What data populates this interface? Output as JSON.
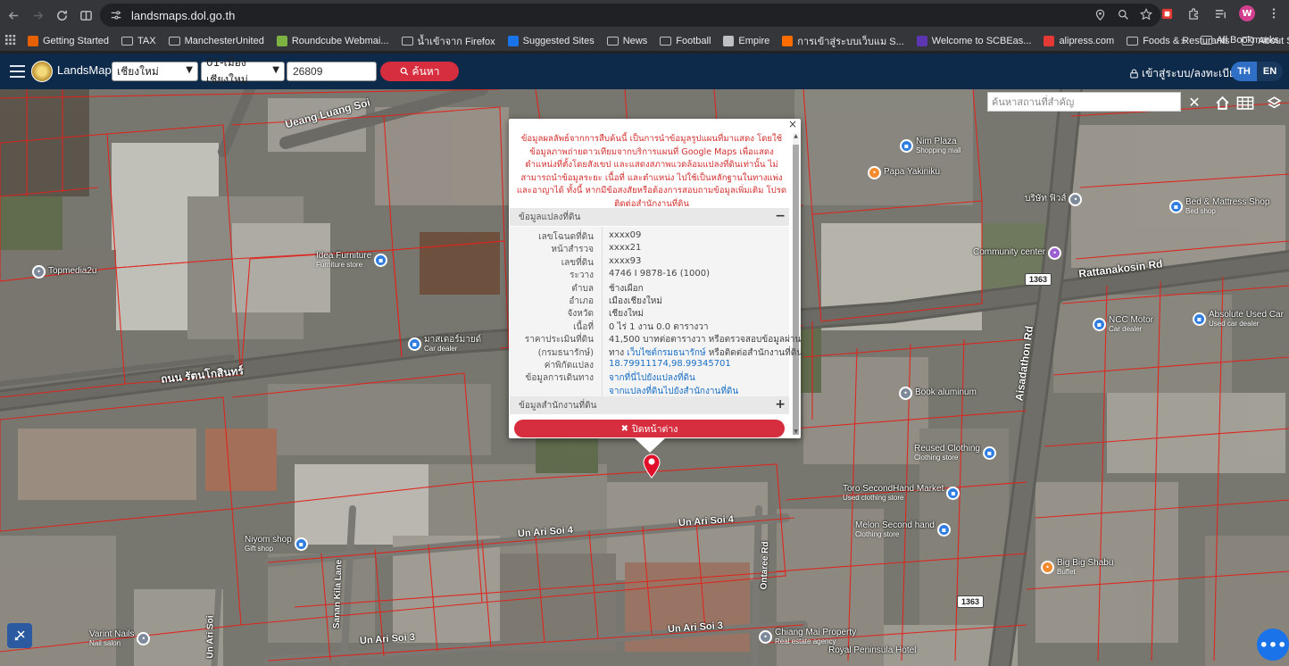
{
  "browser": {
    "url": "landsmaps.dol.go.th",
    "avatar_letter": "W",
    "bookmarks": [
      {
        "label": "Getting Started",
        "type": "fav",
        "color": "#e66000"
      },
      {
        "label": "TAX",
        "type": "folder"
      },
      {
        "label": "ManchesterUnited",
        "type": "folder"
      },
      {
        "label": "Roundcube Webmai...",
        "type": "fav",
        "color": "#7cb342"
      },
      {
        "label": "น้ำเข้าจาก Firefox",
        "type": "folder"
      },
      {
        "label": "Suggested Sites",
        "type": "fav",
        "color": "#1a73e8"
      },
      {
        "label": "News",
        "type": "folder"
      },
      {
        "label": "Football",
        "type": "folder"
      },
      {
        "label": "Empire",
        "type": "fav",
        "color": "#bdc1c6"
      },
      {
        "label": "การเข้าสู่ระบบเว็บแม S...",
        "type": "fav",
        "color": "#ff6d00"
      },
      {
        "label": "Welcome to SCBEas...",
        "type": "fav",
        "color": "#5e35b1"
      },
      {
        "label": "alipress.com",
        "type": "fav",
        "color": "#e53935"
      },
      {
        "label": "Foods & Resturants",
        "type": "folder"
      },
      {
        "label": "About Stock",
        "type": "folder"
      }
    ],
    "all_bookmarks": "All Bookmarks"
  },
  "header": {
    "brand": "LandsMaps",
    "province": "เชียงใหม่",
    "district": "01-เมืองเชียงใหม่",
    "parcel_no": "26809",
    "search_label": "ค้นหา",
    "login_label": "เข้าสู่ระบบ/ลงทะเบียน",
    "lang_th": "TH",
    "lang_en": "EN"
  },
  "map": {
    "search_placeholder": "ค้นหาสถานที่สำคัญ",
    "road_labels": [
      "Ueang Luang Soi",
      "ถนน รัตนโกสินทร์",
      "Rattanakosin Rd",
      "Aisadathon Rd",
      "Un Ari Soi 4",
      "Un Ari Soi 4",
      "Un Ari Soi 3",
      "Un Ari Soi 3",
      "Un Ari Soi",
      "Sanan Kila Lane",
      "Ontaree Rd"
    ],
    "shields": [
      "1363",
      "1363"
    ],
    "pois": [
      {
        "name": "Nim Plaza",
        "sub": "Shopping mall"
      },
      {
        "name": "Papa Yakiniku",
        "sub": ""
      },
      {
        "name": "Topmedia2u",
        "sub": ""
      },
      {
        "name": "Idea Furniture",
        "sub": "Furniture store"
      },
      {
        "name": "มาสเตอร์มายด์",
        "sub": "Car dealer"
      },
      {
        "name": "Bed & Mattress Shop",
        "sub": "Bed shop"
      },
      {
        "name": "NCC Motor",
        "sub": "Car dealer"
      },
      {
        "name": "Absolute Used Car",
        "sub": "Used car dealer"
      },
      {
        "name": "Book aluminum",
        "sub": ""
      },
      {
        "name": "Reused Clothing",
        "sub": "Clothing store"
      },
      {
        "name": "Toro SecondHand Market",
        "sub": "Used clothing store"
      },
      {
        "name": "Melon Second hand",
        "sub": "Clothing store"
      },
      {
        "name": "Big Big Shabu",
        "sub": "Buffet"
      },
      {
        "name": "Niyom shop",
        "sub": "Gift shop"
      },
      {
        "name": "Varint Nails",
        "sub": "Nail salon"
      },
      {
        "name": "Chiang Mai Property",
        "sub": "Real estate agency"
      },
      {
        "name": "Royal Peninsula Hotel",
        "sub": ""
      },
      {
        "name": "Community center",
        "sub": ""
      },
      {
        "name": "บริษัท ฟิวส์",
        "sub": ""
      }
    ]
  },
  "popup": {
    "disclaimer": "ข้อมูลผลลัพธ์จากการสืบค้นนี้ เป็นการนำข้อมูลรูปแผนที่มาแสดง โดยใช้ข้อมูลภาพถ่ายดาวเทียมจากบริการแผนที่ Google Maps เพื่อแสดงตำแหน่งที่ตั้งโดยสังเขป และแสดงสภาพแวดล้อมแปลงที่ดินเท่านั้น ไม่สามารถนำข้อมูลระยะ เนื้อที่ และตำแหน่ง ไปใช้เป็นหลักฐานในทางแพ่งและอาญาได้ ทั้งนี้ หากมีข้อสงสัยหรือต้องการสอบถามข้อมูลเพิ่มเติม โปรดติดต่อสำนักงานที่ดิน",
    "section_parcel": "ข้อมูลแปลงที่ดิน",
    "section_office": "ข้อมูลสำนักงานที่ดิน",
    "rows": [
      {
        "k": "เลขโฉนดที่ดิน",
        "v": "xxxx09"
      },
      {
        "k": "หน้าสำรวจ",
        "v": "xxxx21"
      },
      {
        "k": "เลขที่ดิน",
        "v": "xxxx93"
      },
      {
        "k": "ระวาง",
        "v": "4746 I 9878-16 (1000)"
      },
      {
        "k": "ตำบล",
        "v": "ช้างเผือก"
      },
      {
        "k": "อำเภอ",
        "v": "เมืองเชียงใหม่"
      },
      {
        "k": "จังหวัด",
        "v": "เชียงใหม่"
      },
      {
        "k": "เนื้อที่",
        "v": "0 ไร่ 1 งาน 0.0 ตารางวา"
      },
      {
        "k": "ราคาประเมินที่ดิน",
        "v": "41,500 บาทต่อตารางวา หรือตรวจสอบข้อมูลผ่าน"
      },
      {
        "k": "(กรมธนารักษ์)",
        "v_pre": "ทาง ",
        "v_link": "เว็บไซต์กรมธนารักษ์",
        "v_post": " หรือติดต่อสำนักงานที่ดิน"
      },
      {
        "k": "ค่าพิกัดแปลง",
        "v_link": "18.79911174,98.99345701"
      },
      {
        "k": "ข้อมูลการเดินทาง",
        "v_link": "จากที่นี่ไปยังแปลงที่ดิน"
      },
      {
        "k": "",
        "v_link": "จากแปลงที่ดินไปยังสำนักงานที่ดิน"
      }
    ],
    "close_label": "ปิดหน้าต่าง"
  }
}
